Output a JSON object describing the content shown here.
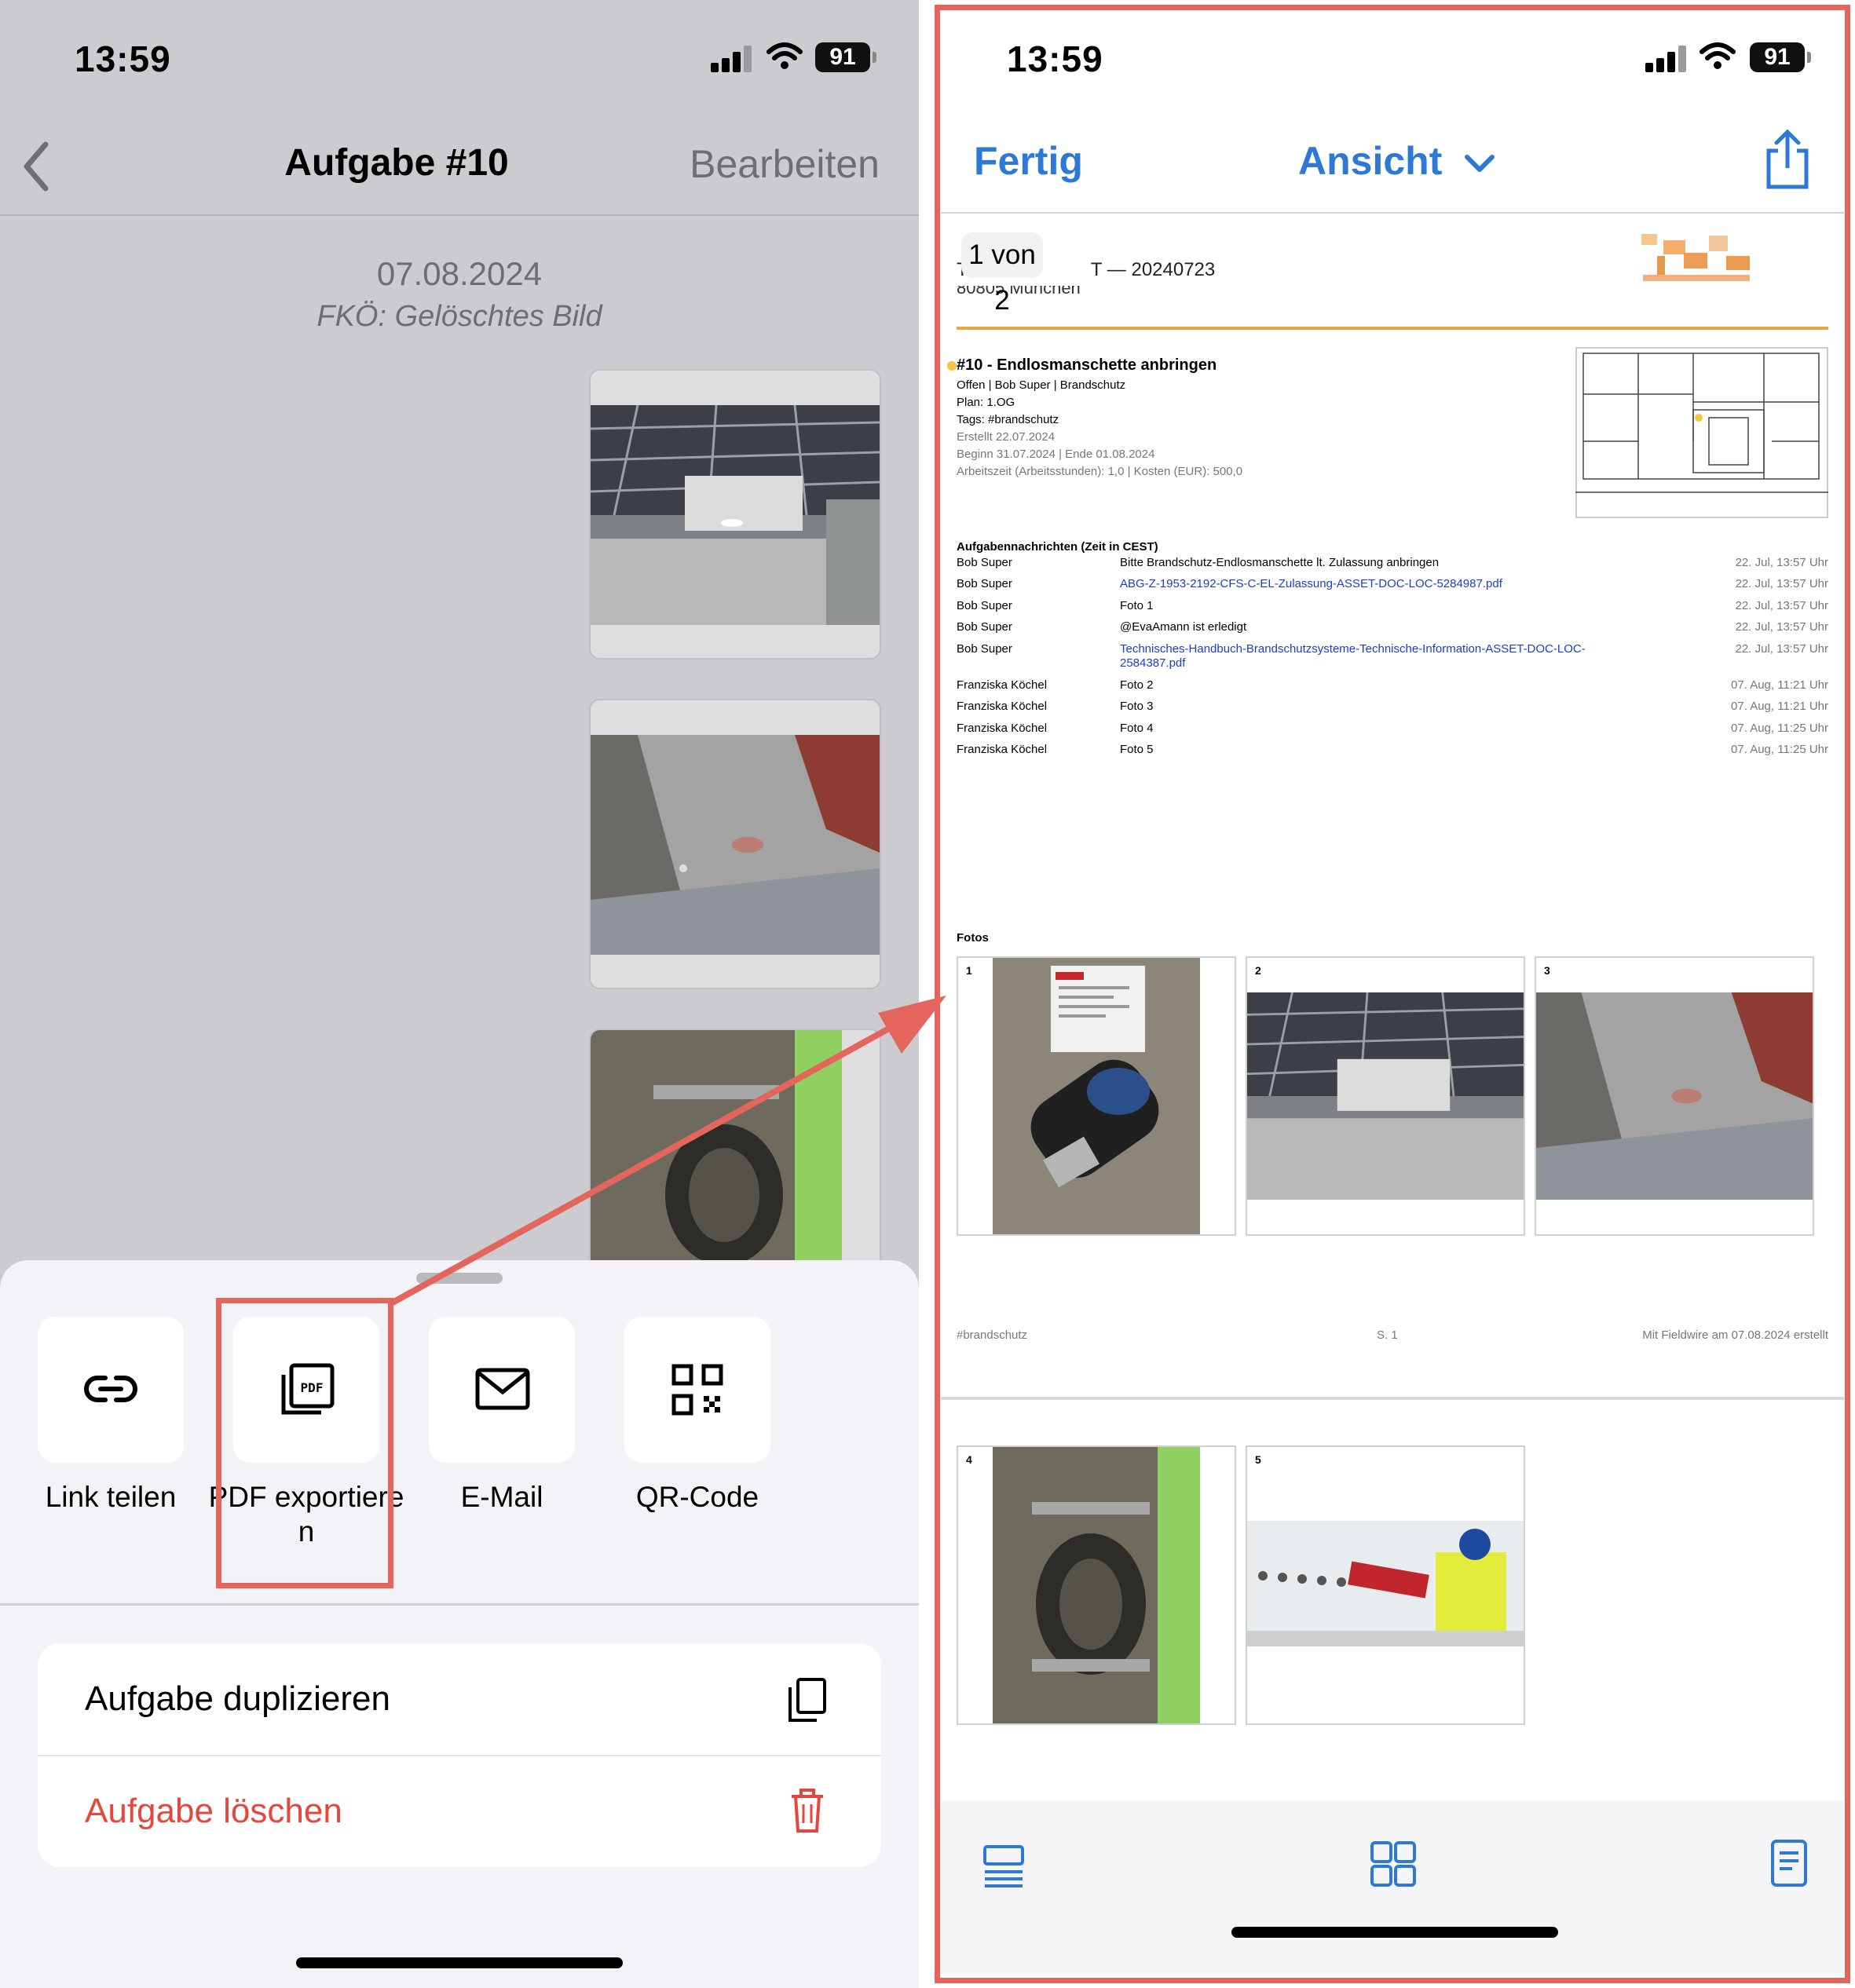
{
  "left_screen": {
    "status": {
      "time": "13:59",
      "battery": "91"
    },
    "nav": {
      "title": "Aufgabe #10",
      "right_button": "Bearbeiten"
    },
    "date": "07.08.2024",
    "subtitle": "FKÖ: Gelöschtes Bild",
    "sheet": {
      "actions": [
        {
          "label": "Link teilen",
          "icon": "link-icon"
        },
        {
          "label": "PDF exportieren",
          "icon": "pdf-icon"
        },
        {
          "label": "E-Mail",
          "icon": "mail-icon"
        },
        {
          "label": "QR-Code",
          "icon": "qr-code-icon"
        }
      ],
      "menu": [
        {
          "label": "Aufgabe duplizieren",
          "icon": "duplicate-icon"
        },
        {
          "label": "Aufgabe löschen",
          "icon": "trash-icon"
        }
      ]
    }
  },
  "right_screen": {
    "status": {
      "time": "13:59",
      "battery": "91"
    },
    "nav": {
      "left": "Fertig",
      "center": "Ansicht",
      "right_icon": "share-icon"
    },
    "page_indicator": "1 von 2",
    "doc": {
      "header_suffix": "T — 20240723",
      "header_line2": "80805 München",
      "task_title": "#10 - Endlosmanschette anbringen",
      "task_meta": "Offen | Bob Super | Brandschutz",
      "plan": "Plan: 1.OG",
      "tags": "Tags: #brandschutz",
      "created": "Erstellt 22.07.2024",
      "dates": "Beginn 31.07.2024  |  Ende 01.08.2024",
      "costs": "Arbeitszeit (Arbeitsstunden): 1,0  |  Kosten (EUR): 500,0",
      "messages_heading": "Aufgabennachrichten (Zeit in CEST)",
      "messages": [
        {
          "author": "Bob Super",
          "text": "Bitte Brandschutz-Endlosmanschette lt. Zulassung anbringen",
          "time": "22. Jul, 13:57 Uhr",
          "link": false
        },
        {
          "author": "Bob Super",
          "text": "ABG-Z-1953-2192-CFS-C-EL-Zulassung-ASSET-DOC-LOC-5284987.pdf",
          "time": "22. Jul, 13:57 Uhr",
          "link": true
        },
        {
          "author": "Bob Super",
          "text": "Foto 1",
          "time": "22. Jul, 13:57 Uhr",
          "link": false
        },
        {
          "author": "Bob Super",
          "text": "@EvaAmann ist erledigt",
          "time": "22. Jul, 13:57 Uhr",
          "link": false
        },
        {
          "author": "Bob Super",
          "text": "Technisches-Handbuch-Brandschutzsysteme-Technische-Information-ASSET-DOC-LOC-",
          "text2": "2584387.pdf",
          "time": "22. Jul, 13:57 Uhr",
          "link": true
        },
        {
          "author": "Franziska Köchel",
          "text": "Foto 2",
          "time": "07. Aug, 11:21 Uhr",
          "link": false
        },
        {
          "author": "Franziska Köchel",
          "text": "Foto 3",
          "time": "07. Aug, 11:21 Uhr",
          "link": false
        },
        {
          "author": "Franziska Köchel",
          "text": "Foto 4",
          "time": "07. Aug, 11:25 Uhr",
          "link": false
        },
        {
          "author": "Franziska Köchel",
          "text": "Foto 5",
          "time": "07. Aug, 11:25 Uhr",
          "link": false
        }
      ],
      "photos_heading": "Fotos",
      "photo_numbers": [
        "1",
        "2",
        "3",
        "4",
        "5"
      ],
      "footer": {
        "left": "#brandschutz",
        "center": "S. 1",
        "right": "Mit Fieldwire am 07.08.2024 erstellt"
      }
    },
    "toolbar": [
      "list-view-icon",
      "grid-view-icon",
      "document-view-icon"
    ]
  },
  "colors": {
    "accent_blue": "#2d7ad6",
    "highlight_red": "#e4655b",
    "delete_red": "#e5473d",
    "orange_rule": "#f2a23b"
  }
}
